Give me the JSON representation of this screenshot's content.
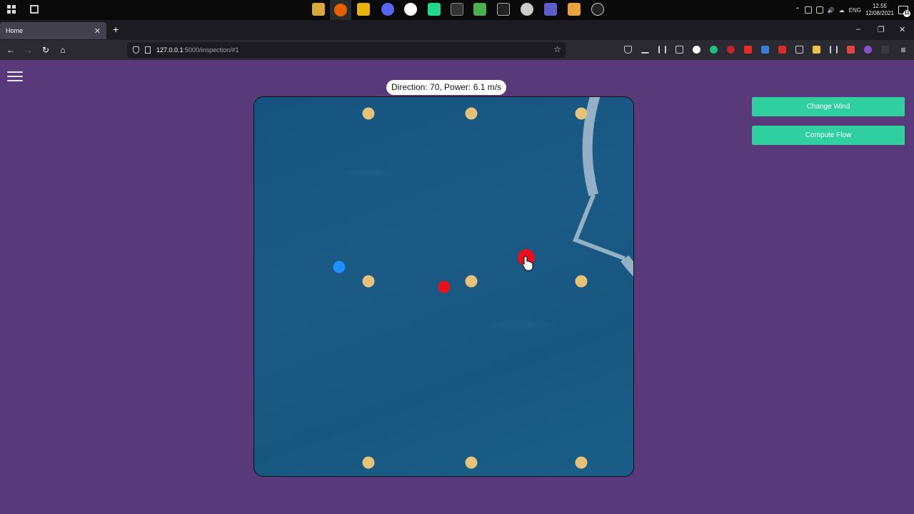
{
  "taskbar": {
    "tray": {
      "language": "ENG",
      "time": "12.55",
      "date": "12/08/2021",
      "notification_count": "11"
    }
  },
  "browser": {
    "tab_title": "Home",
    "tab_close": "✕",
    "new_tab": "+",
    "url_host": "127.0.0.1",
    "url_path": ":5000/inspection/#1",
    "window_controls": {
      "minimize": "–",
      "restore": "❐",
      "close": "✕"
    }
  },
  "app": {
    "wind_label": "Direction: 70, Power: 6.1 m/s",
    "wind": {
      "direction": 70,
      "power_mps": 6.1
    },
    "buttons": {
      "change_wind": "Change Wind",
      "compute_flow": "Compute Flow"
    },
    "colors": {
      "background": "#583a7b",
      "accent": "#2fcfa0",
      "turbine": "#e6c27a",
      "boundary": "#a9bfd1",
      "marker_red": "#e8101b",
      "marker_blue": "#1e90ff"
    },
    "icons": [
      "hamburger-menu-icon",
      "turbine-icon",
      "target-marker-icon",
      "drone-marker-icon",
      "hand-pointer-icon"
    ]
  }
}
